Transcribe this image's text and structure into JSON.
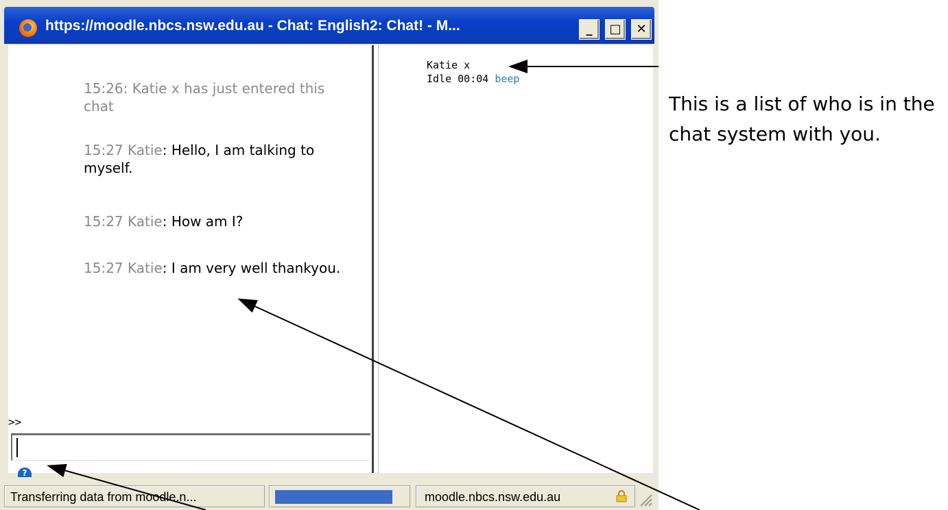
{
  "window": {
    "title": "https://moodle.nbcs.nsw.edu.au - Chat: English2: Chat! - M...",
    "buttons": {
      "minimize": "_",
      "maximize": "□",
      "close": "✕"
    }
  },
  "chat": {
    "messages": [
      {
        "time": "15:26:",
        "text": "Katie x has just entered this chat",
        "system": true
      },
      {
        "time": "15:27 Katie",
        "text": ": Hello, I am talking to myself."
      },
      {
        "time": "15:27 Katie",
        "text": ": How am I?"
      },
      {
        "time": "15:27 Katie",
        "text": ": I am very well thankyou."
      }
    ],
    "prompt": ">>",
    "input_value": ""
  },
  "users": {
    "name": "Katie x",
    "idle": "Idle 00:04",
    "beep": "beep"
  },
  "status": {
    "text": "Transferring data from moodle.n...",
    "progress": 0.9,
    "domain": "moodle.nbcs.nsw.edu.au"
  },
  "annotation": {
    "text": "This is a list of who is in the chat system with you."
  },
  "colors": {
    "titlebar": "#0b3bb5",
    "link": "#2080c0",
    "progress": "#3a6cc8"
  }
}
